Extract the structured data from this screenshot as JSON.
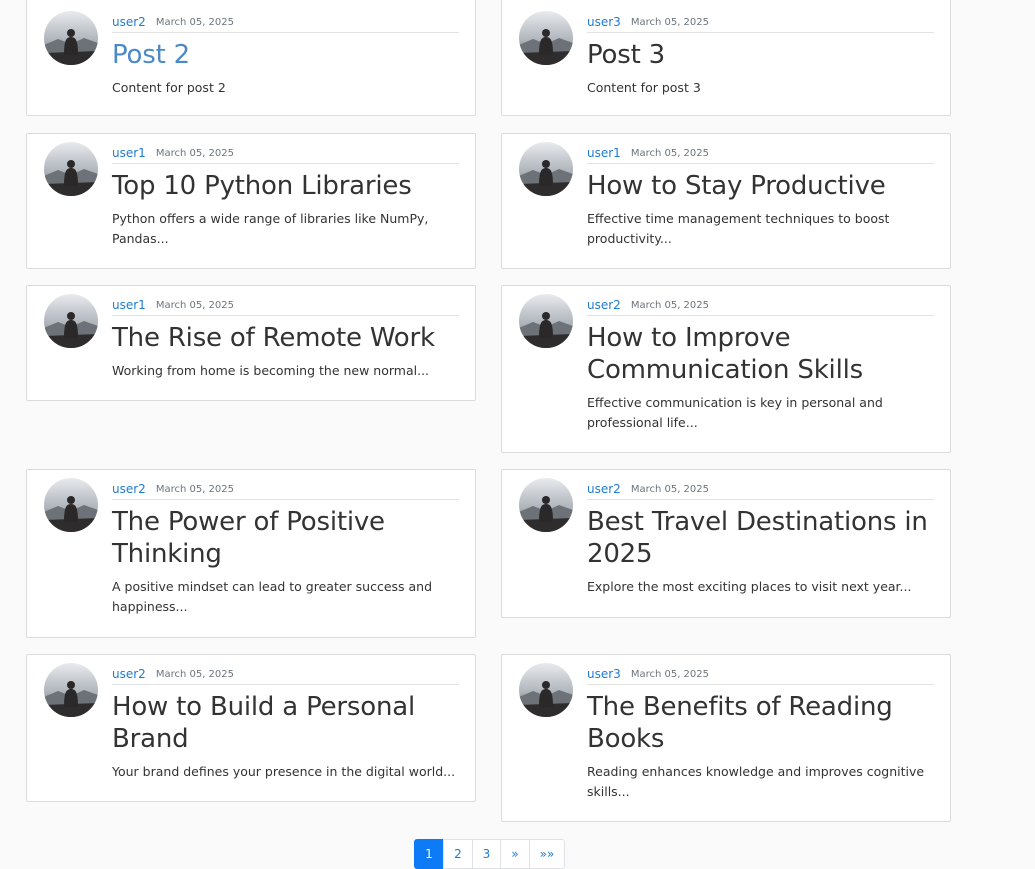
{
  "posts": [
    {
      "author": "user2",
      "date": "March 05, 2025",
      "title": "Post 2",
      "excerpt": "Content for post 2"
    },
    {
      "author": "user3",
      "date": "March 05, 2025",
      "title": "Post 3",
      "excerpt": "Content for post 3"
    },
    {
      "author": "user1",
      "date": "March 05, 2025",
      "title": "Top 10 Python Libraries",
      "excerpt": "Python offers a wide range of libraries like NumPy, Pandas..."
    },
    {
      "author": "user1",
      "date": "March 05, 2025",
      "title": "How to Stay Productive",
      "excerpt": "Effective time management techniques to boost productivity..."
    },
    {
      "author": "user1",
      "date": "March 05, 2025",
      "title": "The Rise of Remote Work",
      "excerpt": "Working from home is becoming the new normal..."
    },
    {
      "author": "user2",
      "date": "March 05, 2025",
      "title": "How to Improve Communication Skills",
      "excerpt": "Effective communication is key in personal and professional life..."
    },
    {
      "author": "user2",
      "date": "March 05, 2025",
      "title": "The Power of Positive Thinking",
      "excerpt": "A positive mindset can lead to greater success and happiness..."
    },
    {
      "author": "user2",
      "date": "March 05, 2025",
      "title": "Best Travel Destinations in 2025",
      "excerpt": "Explore the most exciting places to visit next year..."
    },
    {
      "author": "user2",
      "date": "March 05, 2025",
      "title": "How to Build a Personal Brand",
      "excerpt": "Your brand defines your presence in the digital world..."
    },
    {
      "author": "user3",
      "date": "March 05, 2025",
      "title": "The Benefits of Reading Books",
      "excerpt": "Reading enhances knowledge and improves cognitive skills..."
    }
  ],
  "pagination": {
    "pages": [
      "1",
      "2",
      "3"
    ],
    "next_label": "»",
    "last_label": "»»",
    "active_page": "1"
  },
  "colors": {
    "link": "#1f7bd2",
    "active_page": "#0d7bf6",
    "hover_title": "#4a8ac6"
  },
  "icons": {
    "avatar": "user-avatar-icon"
  }
}
